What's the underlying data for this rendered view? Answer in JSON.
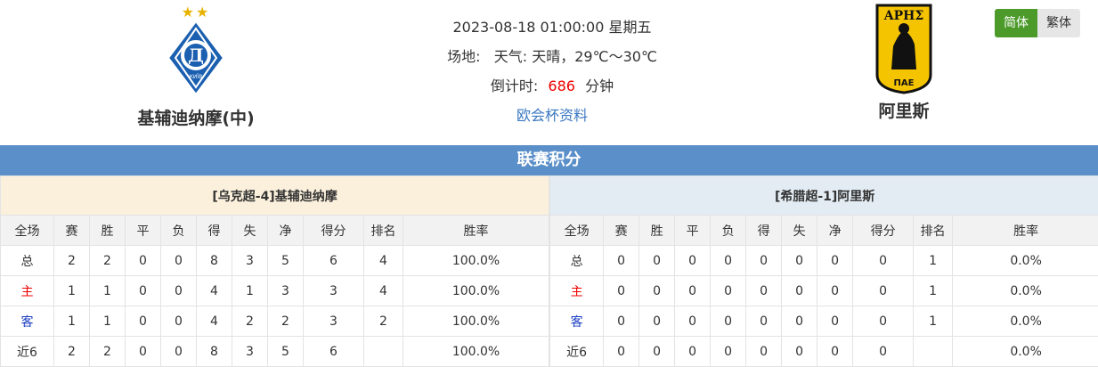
{
  "home": {
    "name": "基辅迪纳摩(中)",
    "logo_text": "КИЇВ",
    "stars": "★★"
  },
  "away": {
    "name": "阿里斯",
    "logo_top": "ΑΡΗΣ",
    "logo_bottom": "ΠΑΕ"
  },
  "match": {
    "datetime": "2023-08-18 01:00:00 星期五",
    "venue_label": "场地:",
    "weather_label": "天气:",
    "weather": "天晴，29℃～30℃",
    "countdown_label": "倒计时:",
    "countdown_value": "686",
    "countdown_unit": "分钟",
    "link": "欧会杯资料"
  },
  "lang": {
    "simplified": "简体",
    "traditional": "繁体"
  },
  "section_title": "联赛积分",
  "columns": [
    "全场",
    "赛",
    "胜",
    "平",
    "负",
    "得",
    "失",
    "净",
    "得分",
    "排名",
    "胜率"
  ],
  "home_table": {
    "title": "[乌克超-4]基辅迪纳摩",
    "rows": [
      {
        "label": "总",
        "cells": [
          "2",
          "2",
          "0",
          "0",
          "8",
          "3",
          "5",
          "6",
          "4",
          "100.0%"
        ]
      },
      {
        "label": "主",
        "cells": [
          "1",
          "1",
          "0",
          "0",
          "4",
          "1",
          "3",
          "3",
          "4",
          "100.0%"
        ]
      },
      {
        "label": "客",
        "cells": [
          "1",
          "1",
          "0",
          "0",
          "4",
          "2",
          "2",
          "3",
          "2",
          "100.0%"
        ]
      },
      {
        "label": "近6",
        "cells": [
          "2",
          "2",
          "0",
          "0",
          "8",
          "3",
          "5",
          "6",
          "",
          "100.0%"
        ]
      }
    ]
  },
  "away_table": {
    "title": "[希腊超-1]阿里斯",
    "rows": [
      {
        "label": "总",
        "cells": [
          "0",
          "0",
          "0",
          "0",
          "0",
          "0",
          "0",
          "0",
          "1",
          "0.0%"
        ]
      },
      {
        "label": "主",
        "cells": [
          "0",
          "0",
          "0",
          "0",
          "0",
          "0",
          "0",
          "0",
          "1",
          "0.0%"
        ]
      },
      {
        "label": "客",
        "cells": [
          "0",
          "0",
          "0",
          "0",
          "0",
          "0",
          "0",
          "0",
          "1",
          "0.0%"
        ]
      },
      {
        "label": "近6",
        "cells": [
          "0",
          "0",
          "0",
          "0",
          "0",
          "0",
          "0",
          "0",
          "",
          "0.0%"
        ]
      }
    ]
  },
  "colors": {
    "bar": "#5b8fc9",
    "home_title_bg": "#fbf0dc",
    "away_title_bg": "#e3ecf3",
    "home_label": "#e00000",
    "away_label": "#1a3ec2"
  }
}
